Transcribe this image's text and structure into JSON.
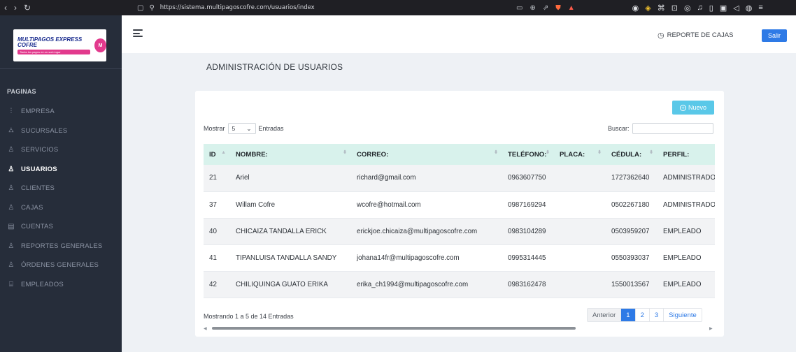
{
  "browser": {
    "url": "https://sistema.multipagoscofre.com/usuarios/index"
  },
  "sidebar": {
    "logo_text": "MULTIPAGOS EXPRESS COFRE",
    "logo_sub": "Todos los pagos en un solo lugar",
    "logo_mark": "M",
    "section_label": "PAGINAS",
    "items": [
      {
        "label": "EMPRESA",
        "icon": "sliders-icon"
      },
      {
        "label": "SUCURSALES",
        "icon": "sitemap-icon"
      },
      {
        "label": "SERVICIOS",
        "icon": "user-icon"
      },
      {
        "label": "USUARIOS",
        "icon": "user-icon",
        "active": true
      },
      {
        "label": "CLIENTES",
        "icon": "user-icon"
      },
      {
        "label": "CAJAS",
        "icon": "user-icon"
      },
      {
        "label": "CUENTAS",
        "icon": "wallet-icon"
      },
      {
        "label": "REPORTES GENERALES",
        "icon": "user-icon"
      },
      {
        "label": "ÓRDENES GENERALES",
        "icon": "user-icon"
      },
      {
        "label": "EMPLEADOS",
        "icon": "id-card-icon"
      }
    ]
  },
  "header": {
    "report_label": "REPORTE DE CAJAS",
    "logout_label": "Salir"
  },
  "page": {
    "title": "ADMINISTRACIÓN DE USUARIOS"
  },
  "table_controls": {
    "new_label": "Nuevo",
    "show_label": "Mostrar",
    "page_size": "5",
    "entries_label": "Entradas",
    "search_label": "Buscar:",
    "search_value": ""
  },
  "table": {
    "columns": [
      "ID",
      "NOMBRE:",
      "CORREO:",
      "TELÉFONO:",
      "PLACA:",
      "CÉDULA:",
      "PERFIL:"
    ],
    "rows": [
      [
        "21",
        "Ariel",
        "richard@gmail.com",
        "0963607750",
        "",
        "1727362640",
        "ADMINISTRADOR"
      ],
      [
        "37",
        "Willam Cofre",
        "wcofre@hotmail.com",
        "0987169294",
        "",
        "0502267180",
        "ADMINISTRADOR"
      ],
      [
        "40",
        "CHICAIZA TANDALLA ERICK",
        "erickjoe.chicaiza@multipagoscofre.com",
        "0983104289",
        "",
        "0503959207",
        "EMPLEADO"
      ],
      [
        "41",
        "TIPANLUISA TANDALLA SANDY",
        "johana14fr@multipagoscofre.com",
        "0995314445",
        "",
        "0550393037",
        "EMPLEADO"
      ],
      [
        "42",
        "CHILIQUINGA GUATO ERIKA",
        "erika_ch1994@multipagoscofre.com",
        "0983162478",
        "",
        "1550013567",
        "EMPLEADO"
      ]
    ]
  },
  "footer": {
    "info": "Mostrando 1 a 5 de 14 Entradas",
    "prev_label": "Anterior",
    "pages": [
      "1",
      "2",
      "3"
    ],
    "current_page": "1",
    "next_label": "Siguiente"
  },
  "colors": {
    "sidebar_bg": "#262d3a",
    "primary": "#2e7ae6",
    "new_button": "#5ac8e8",
    "table_header": "#d8f2ec"
  }
}
